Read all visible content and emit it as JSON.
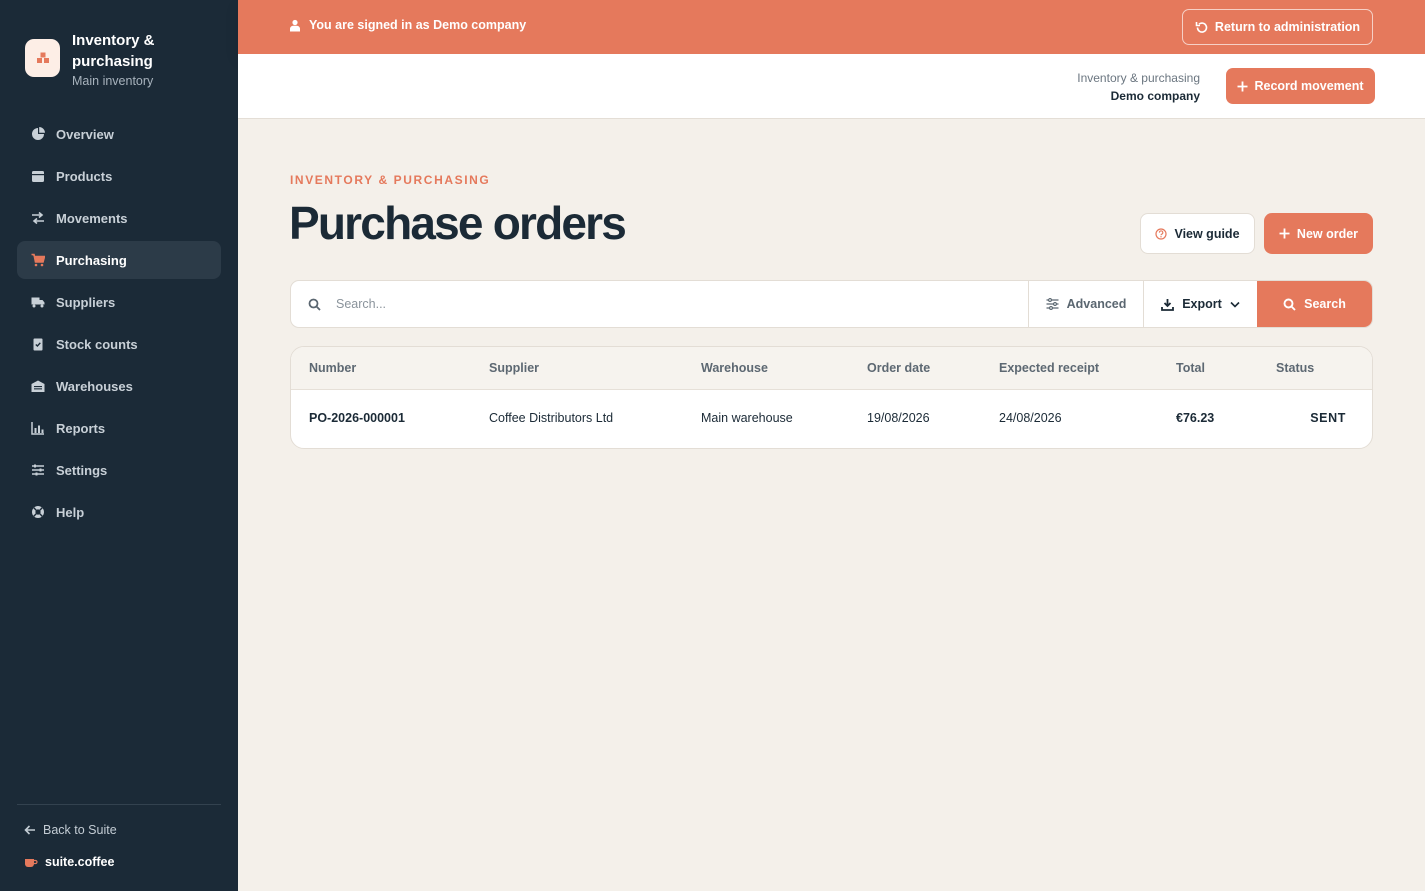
{
  "sidebar": {
    "brand_title": "Inventory & purchasing",
    "brand_subtitle": "Main inventory",
    "items": [
      {
        "label": "Overview",
        "icon": "pie-chart-icon"
      },
      {
        "label": "Products",
        "icon": "box-icon"
      },
      {
        "label": "Movements",
        "icon": "swap-arrows-icon"
      },
      {
        "label": "Purchasing",
        "icon": "cart-icon",
        "active": true
      },
      {
        "label": "Suppliers",
        "icon": "truck-icon"
      },
      {
        "label": "Stock counts",
        "icon": "clipboard-check-icon"
      },
      {
        "label": "Warehouses",
        "icon": "warehouse-icon"
      },
      {
        "label": "Reports",
        "icon": "bar-chart-icon"
      },
      {
        "label": "Settings",
        "icon": "sliders-icon"
      },
      {
        "label": "Help",
        "icon": "lifebuoy-icon"
      }
    ],
    "back_label": "Back to Suite",
    "suite_label": "suite.coffee"
  },
  "banner": {
    "message": "You are signed in as Demo company",
    "return_label": "Return to administration"
  },
  "header": {
    "context_app": "Inventory & purchasing",
    "context_company": "Demo company",
    "record_label": "Record movement"
  },
  "page": {
    "eyebrow": "INVENTORY & PURCHASING",
    "title": "Purchase orders",
    "guide_label": "View guide",
    "new_label": "New order"
  },
  "search": {
    "placeholder": "Search...",
    "advanced_label": "Advanced",
    "export_label": "Export",
    "search_label": "Search"
  },
  "table": {
    "columns": [
      "Number",
      "Supplier",
      "Warehouse",
      "Order date",
      "Expected receipt",
      "Total",
      "Status"
    ],
    "rows": [
      {
        "number": "PO-2026-000001",
        "supplier": "Coffee Distributors Ltd",
        "warehouse": "Main warehouse",
        "order_date": "19/08/2026",
        "expected_receipt": "24/08/2026",
        "total": "€76.23",
        "status": "SENT"
      }
    ]
  },
  "colors": {
    "accent": "#e5795c",
    "sidebar_bg": "#1b2a37",
    "page_bg": "#f4f0ea"
  }
}
